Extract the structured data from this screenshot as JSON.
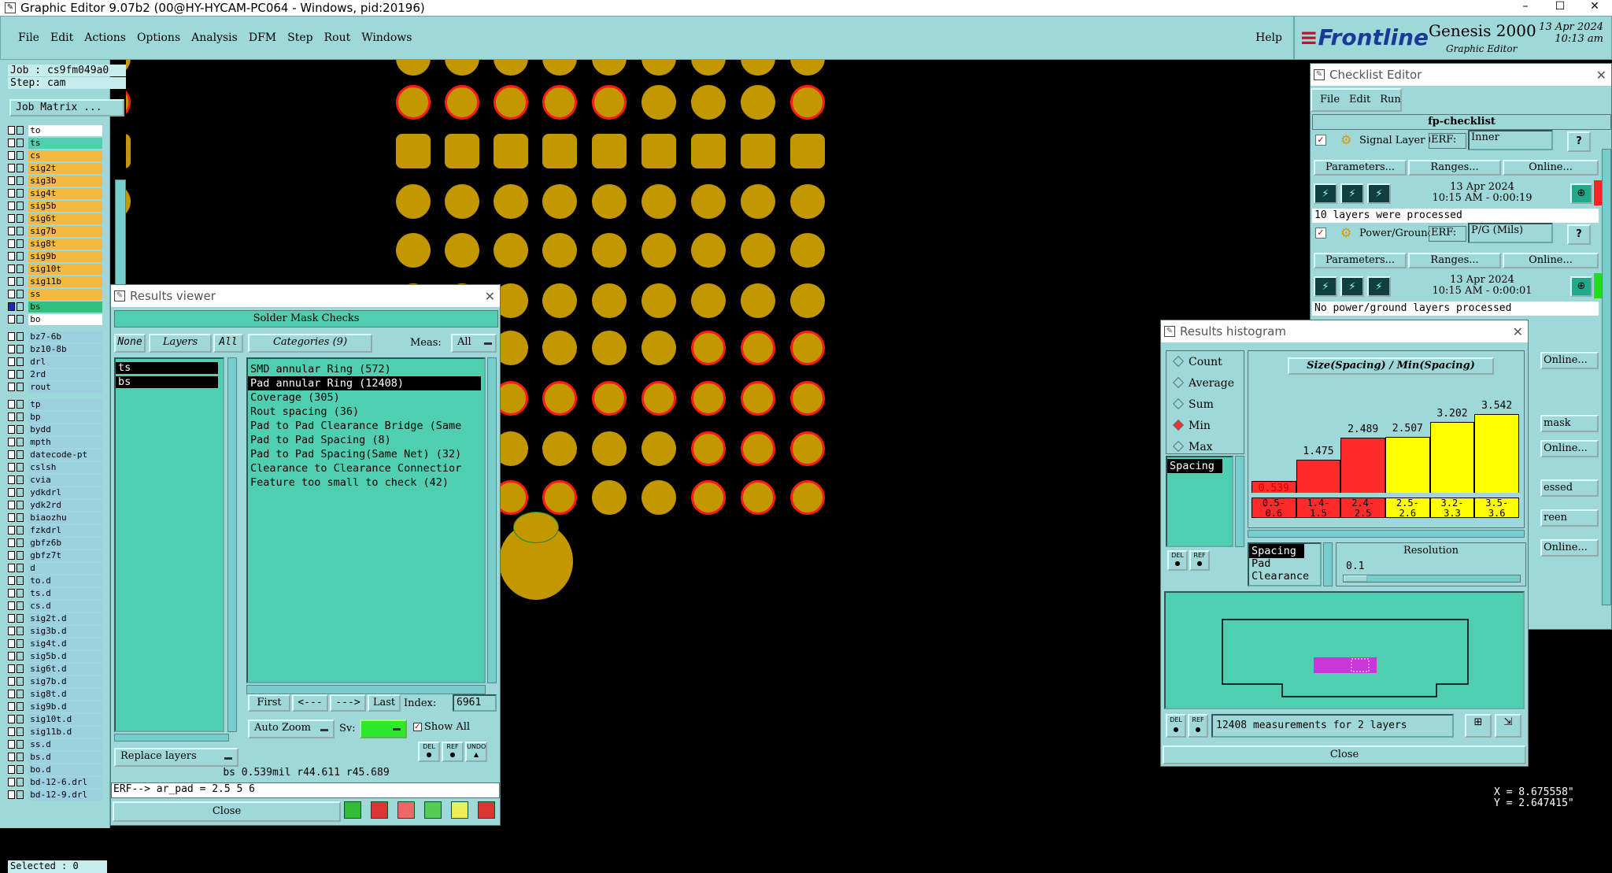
{
  "window": {
    "title": "Graphic Editor 9.07b2 (00@HY-HYCAM-PC064 - Windows, pid:20196)",
    "minimize": "–",
    "maximize": "☐",
    "close": "✕"
  },
  "menu": [
    "File",
    "Edit",
    "Actions",
    "Options",
    "Analysis",
    "DFM",
    "Step",
    "Rout",
    "Windows"
  ],
  "help": "Help",
  "brand": {
    "logo": "Frontline",
    "product": "Genesis 2000",
    "sub": "Graphic Editor",
    "date": "13 Apr 2024",
    "time": "10:13 am"
  },
  "job": {
    "job_line": "Job : cs9fm049a0",
    "step_line": "Step: cam",
    "matrix_button": "Job Matrix ..."
  },
  "layers_top": [
    {
      "name": "to",
      "color": "#ffffff"
    },
    {
      "name": "ts",
      "color": "#4fcfb0"
    },
    {
      "name": "cs",
      "color": "#f5b940"
    },
    {
      "name": "sig2t",
      "color": "#f5b940"
    },
    {
      "name": "sig3b",
      "color": "#f5b940"
    },
    {
      "name": "sig4t",
      "color": "#f5b940"
    },
    {
      "name": "sig5b",
      "color": "#f5b940"
    },
    {
      "name": "sig6t",
      "color": "#f5b940"
    },
    {
      "name": "sig7b",
      "color": "#f5b940"
    },
    {
      "name": "sig8t",
      "color": "#f5b940"
    },
    {
      "name": "sig9b",
      "color": "#f5b940"
    },
    {
      "name": "sig10t",
      "color": "#f5b940"
    },
    {
      "name": "sig11b",
      "color": "#f5b940"
    },
    {
      "name": "ss",
      "color": "#f5b940"
    },
    {
      "name": "bs",
      "color": "#2ec27e"
    },
    {
      "name": "bo",
      "color": "#ffffff"
    }
  ],
  "layers_drill": [
    "bz7-6b",
    "bz10-8b",
    "drl",
    "2rd",
    "rout"
  ],
  "layers_misc": [
    "tp",
    "bp",
    "bydd",
    "mpth",
    "datecode-pt",
    "cslsh",
    "cvia",
    "ydkdrl",
    "ydk2rd",
    "biaozhu",
    "fzkdrl",
    "gbfz6b",
    "gbfz7t",
    "d",
    "to.d",
    "ts.d",
    "cs.d",
    "sig2t.d",
    "sig3b.d",
    "sig4t.d",
    "sig5b.d",
    "sig6t.d",
    "sig7b.d",
    "sig8t.d",
    "sig9b.d",
    "sig10t.d",
    "sig11b.d",
    "ss.d",
    "bs.d",
    "bo.d",
    "bd-12-6.drl",
    "bd-12-9.drl"
  ],
  "selected": "Selected : 0",
  "results_viewer": {
    "title": "Results viewer",
    "header": "Solder Mask Checks",
    "none": "None",
    "layers": "Layers",
    "all": "All",
    "categories_label": "Categories (9)",
    "meas_label": "Meas:",
    "meas_value": "All",
    "layer_list": [
      "ts",
      "bs"
    ],
    "categories": [
      "SMD annular Ring (572)",
      "Pad annular Ring (12408)",
      "Coverage (305)",
      "Rout spacing (36)",
      "Pad to Pad Clearance Bridge (Same",
      "Pad to Pad Spacing (8)",
      "Pad to Pad Spacing(Same Net) (32)",
      "Clearance to Clearance Connectior",
      "Feature too small to check (42)"
    ],
    "selected_index": 1,
    "nav": {
      "first": "First",
      "prev": "<---",
      "next": "--->",
      "last": "Last",
      "index_label": "Index:",
      "index_value": "6961"
    },
    "zoom": "Auto Zoom",
    "sv": "Sv:",
    "show_all": "Show All",
    "replace": "Replace layers",
    "status": "bs 0.539mil  r44.611  r45.689",
    "erf": "ERF--> ar_pad = 2.5 5 6",
    "close": "Close"
  },
  "checklist": {
    "title": "Checklist Editor",
    "menu": [
      "File",
      "Edit",
      "Run"
    ],
    "name": "fp-checklist",
    "items": [
      {
        "name": "Signal Layer Ch",
        "erf_label": "ERF:",
        "erf": "Inner",
        "params": "Parameters...",
        "ranges": "Ranges...",
        "online": "Online...",
        "date": "13 Apr 2024",
        "time": "10:15 AM - 0:00:19",
        "msg": "10 layers were processed",
        "status": "#ff2222"
      },
      {
        "name": "Power/Ground C",
        "erf_label": "ERF:",
        "erf": "P/G (Mils)",
        "params": "Parameters...",
        "ranges": "Ranges...",
        "online": "Online...",
        "date": "13 Apr 2024",
        "time": "10:15 AM - 0:00:01",
        "msg": "No power/ground layers processed",
        "status": "#22dd22"
      }
    ],
    "partial": [
      "Online...",
      "mask",
      "Online...",
      "essed",
      "reen",
      "Online..."
    ]
  },
  "histogram": {
    "title": "Results histogram",
    "modes": [
      "Count",
      "Average",
      "Sum",
      "Min",
      "Max"
    ],
    "active_mode": "Min",
    "list": [
      "Spacing"
    ],
    "chart_title": "Size(Spacing) / Min(Spacing)",
    "chart_data": {
      "type": "bar",
      "title": "Size(Spacing) / Min(Spacing)",
      "categories": [
        "0.5-0.6",
        "1.4-1.5",
        "2.4-2.5",
        "2.5-2.6",
        "3.2-3.3",
        "3.5-3.6"
      ],
      "values": [
        0.539,
        1.475,
        2.489,
        2.507,
        3.202,
        3.542
      ],
      "labels": [
        "0.539",
        "1.475",
        "2.489",
        "2.507",
        "3.202",
        "3.542"
      ],
      "bar_colors": [
        "#ff2a2a",
        "#ff2a2a",
        "#ff2a2a",
        "#ffff00",
        "#ffff00",
        "#ffff00"
      ]
    },
    "axis_labels": [
      [
        "0.5-",
        "0.6"
      ],
      [
        "1.4-",
        "1.5"
      ],
      [
        "2.4-",
        "2.5"
      ],
      [
        "2.5-",
        "2.6"
      ],
      [
        "3.2-",
        "3.3"
      ],
      [
        "3.5-",
        "3.6"
      ]
    ],
    "types": [
      "Spacing",
      "Pad",
      "Clearance"
    ],
    "resolution_label": "Resolution",
    "resolution_value": "0.1",
    "status": "12408 measurements for 2 layers",
    "close": "Close"
  },
  "coords": {
    "x": "X = 8.675558\"",
    "y": "Y = 2.647415\""
  }
}
